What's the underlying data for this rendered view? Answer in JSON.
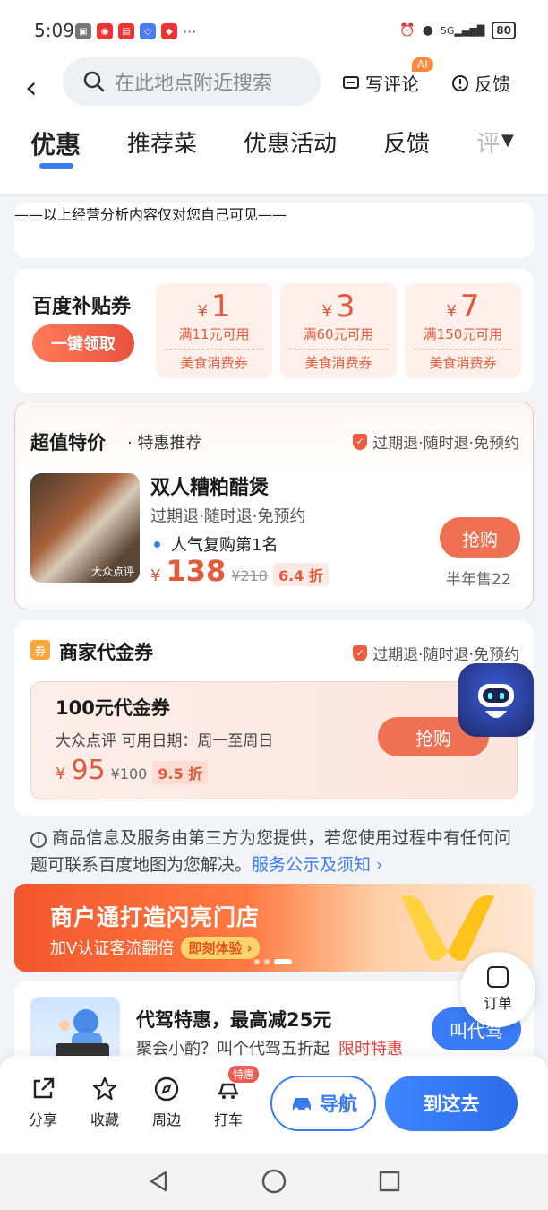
{
  "status_bar": {
    "time": "5:09",
    "battery": "80",
    "signal": "5G"
  },
  "header": {
    "search_placeholder": "在此地点附近搜索",
    "write_review": "写评论",
    "ai_badge": "AI",
    "feedback": "反馈"
  },
  "tabs": [
    "优惠",
    "推荐菜",
    "优惠活动",
    "反馈",
    "评"
  ],
  "notice_visible_only": "——以上经营分析内容仅对您自己可见——",
  "subsidy": {
    "title": "百度补贴券",
    "claim_label": "一键领取",
    "coupons": [
      {
        "symbol": "¥",
        "amount": "1",
        "condition": "满11元可用",
        "kind": "美食消费券"
      },
      {
        "symbol": "¥",
        "amount": "3",
        "condition": "满60元可用",
        "kind": "美食消费券"
      },
      {
        "symbol": "¥",
        "amount": "7",
        "condition": "满150元可用",
        "kind": "美食消费券"
      }
    ]
  },
  "deal": {
    "section_title": "超值特价",
    "section_sub": "· 特惠推荐",
    "guarantee": "过期退·随时退·免预约",
    "thumb_label": "大众点评",
    "name": "双人糟粕醋煲",
    "terms": "过期退·随时退·免预约",
    "rank": "人气复购第1名",
    "currency": "¥",
    "price": "138",
    "original_price": "¥218",
    "discount": "6.4 折",
    "grab_label": "抢购",
    "sold": "半年售22"
  },
  "voucher": {
    "icon_label": "券",
    "section_title": "商家代金券",
    "guarantee": "过期退·随时退·免预约",
    "title": "100元代金券",
    "info": "大众点评   可用日期：周一至周日",
    "currency": "¥",
    "price": "95",
    "original_price": "¥100",
    "discount": "9.5 折",
    "grab_label": "抢购"
  },
  "disclaimer": {
    "text": "商品信息及服务由第三方为您提供，若您使用过程中有任何问题可联系百度地图为您解决。",
    "link": "服务公示及须知 ›"
  },
  "banner": {
    "title": "商户通打造闪亮门店",
    "subtitle": "加V认证客流翻倍",
    "cta": "即刻体验 ›"
  },
  "order_fab": {
    "label": "订单"
  },
  "driver": {
    "title": "代驾特惠，最高减25元",
    "subtitle": "聚会小酌？叫个代驾五折起",
    "tag": "限时特惠",
    "button": "叫代驾"
  },
  "bottom_bar": {
    "share": "分享",
    "favorite": "收藏",
    "nearby": "周边",
    "taxi": "打车",
    "taxi_badge": "特惠",
    "navigate": "导航",
    "go_here": "到这去"
  }
}
